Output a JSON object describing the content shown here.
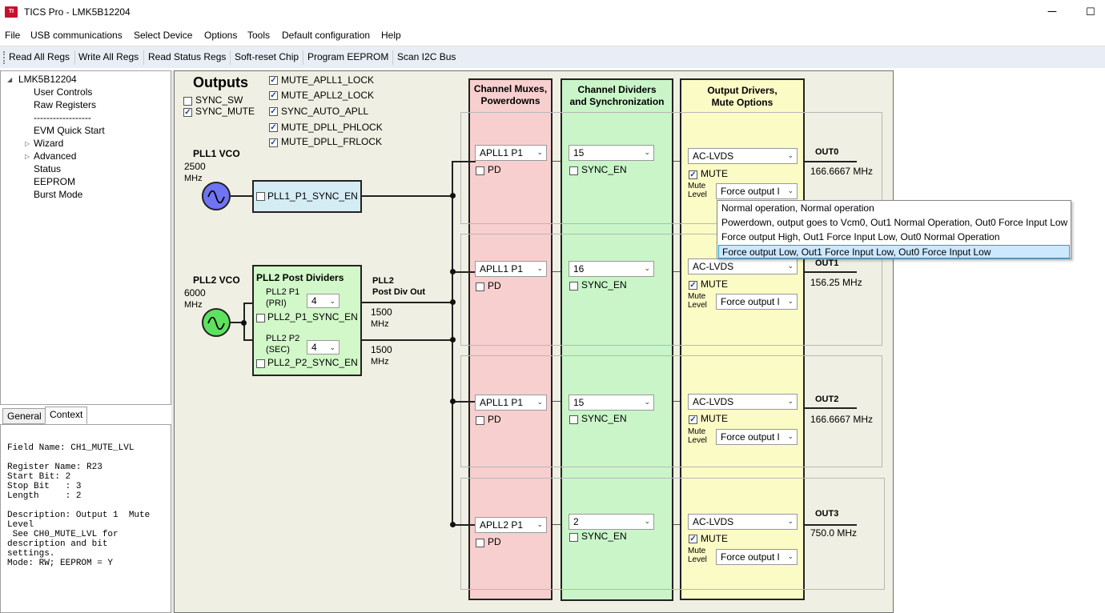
{
  "window": {
    "title": "TICS Pro - LMK5B12204",
    "icon_text": "TI"
  },
  "menu": [
    "File",
    "USB communications",
    "Select Device",
    "Options",
    "Tools",
    "Default configuration",
    "Help"
  ],
  "toolbar": [
    "Read All Regs",
    "Write All Regs",
    "Read Status Regs",
    "Soft-reset Chip",
    "Program EEPROM",
    "Scan I2C Bus"
  ],
  "tree": {
    "root": "LMK5B12204",
    "items": [
      "User Controls",
      "Raw Registers",
      "------------------",
      "EVM Quick Start",
      "Wizard",
      "Advanced",
      "Status",
      "EEPROM",
      "Burst Mode"
    ]
  },
  "tabs": {
    "general": "General",
    "context": "Context"
  },
  "context": [
    "Field Name: CH1_MUTE_LVL",
    "",
    "Register Name: R23",
    "Start Bit: 2",
    "Stop Bit   : 3",
    "Length     : 2",
    "",
    "Description: Output 1  Mute",
    "Level",
    " See CH0_MUTE_LVL for",
    "description and bit",
    "settings.",
    "Mode: RW; EEPROM = Y"
  ],
  "outputs": {
    "title": "Outputs",
    "sync_sw": {
      "label": "SYNC_SW",
      "checked": false
    },
    "sync_mute": {
      "label": "SYNC_MUTE",
      "checked": true
    },
    "checks": [
      {
        "label": "MUTE_APLL1_LOCK",
        "checked": true
      },
      {
        "label": "MUTE_APLL2_LOCK",
        "checked": true
      },
      {
        "label": "SYNC_AUTO_APLL",
        "checked": true
      },
      {
        "label": "MUTE_DPLL_PHLOCK",
        "checked": true
      },
      {
        "label": "MUTE_DPLL_FRLOCK",
        "checked": true
      }
    ]
  },
  "pll1": {
    "label": "PLL1 VCO",
    "freq": "2500",
    "unit": "MHz",
    "sync_en": "PLL1_P1_SYNC_EN"
  },
  "pll2": {
    "label": "PLL2 VCO",
    "freq": "6000",
    "unit": "MHz",
    "post_dividers_title": "PLL2 Post Dividers",
    "p1_label": "PLL2 P1",
    "p1_sub": "(PRI)",
    "p1_value": "4",
    "p1_sync": "PLL2_P1_SYNC_EN",
    "p2_label": "PLL2 P2",
    "p2_sub": "(SEC)",
    "p2_value": "4",
    "p2_sync": "PLL2_P2_SYNC_EN",
    "post_div_out_1": "PLL2",
    "post_div_out_2": "Post Div Out",
    "out1_freq": "1500",
    "out2_freq": "1500"
  },
  "columns": {
    "mux": [
      "Channel Muxes,",
      "Powerdowns"
    ],
    "div": [
      "Channel Dividers",
      "and Synchronization"
    ],
    "drv": [
      "Output Drivers,",
      "Mute Options"
    ]
  },
  "channels": [
    {
      "mux": "APLL1 P1",
      "pd": "PD",
      "div": "15",
      "sync": "SYNC_EN",
      "driver": "AC-LVDS",
      "mute": "MUTE",
      "mute_level_1": "Mute",
      "mute_level_2": "Level",
      "level_value": "Force output l",
      "out": "OUT0",
      "freq": "166.6667 MHz"
    },
    {
      "mux": "APLL1 P1",
      "pd": "PD",
      "div": "16",
      "sync": "SYNC_EN",
      "driver": "AC-LVDS",
      "mute": "MUTE",
      "mute_level_1": "Mute",
      "mute_level_2": "Level",
      "level_value": "Force output l",
      "out": "OUT1",
      "freq": "156.25 MHz"
    },
    {
      "mux": "APLL1 P1",
      "pd": "PD",
      "div": "15",
      "sync": "SYNC_EN",
      "driver": "AC-LVDS",
      "mute": "MUTE",
      "mute_level_1": "Mute",
      "mute_level_2": "Level",
      "level_value": "Force output l",
      "out": "OUT2",
      "freq": "166.6667 MHz"
    },
    {
      "mux": "APLL2 P1",
      "pd": "PD",
      "div": "2",
      "sync": "SYNC_EN",
      "driver": "AC-LVDS",
      "mute": "MUTE",
      "mute_level_1": "Mute",
      "mute_level_2": "Level",
      "level_value": "Force output l",
      "out": "OUT3",
      "freq": "750.0 MHz"
    }
  ],
  "popup_options": [
    "Normal operation, Normal operation",
    "Powerdown, output goes to Vcm0, Out1 Normal Operation, Out0 Force Input Low",
    "Force output High, Out1 Force Input Low,  Out0 Normal Operation",
    "Force output Low, Out1 Force Input Low,  Out0 Force Input Low"
  ],
  "popup_selected": 3,
  "colors": {
    "mux": "#f8cfcf",
    "div": "#c9f5c9",
    "drv": "#fbfbc6",
    "pll1_box": "#d4ecf4",
    "pll2_box": "#d2f7c9",
    "vco1": "#6f74f2",
    "vco2": "#5fe160"
  }
}
